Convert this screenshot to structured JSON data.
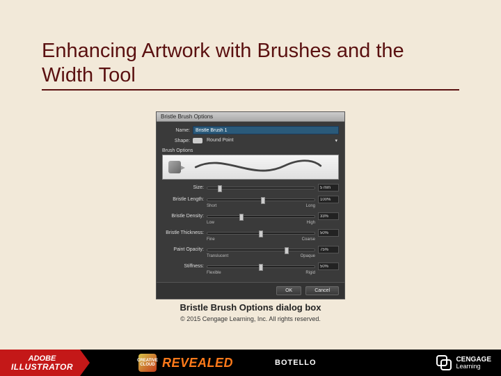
{
  "slide": {
    "title": "Enhancing Artwork with Brushes and the Width Tool",
    "caption": "Bristle Brush Options dialog box",
    "copyright": "© 2015 Cengage Learning, Inc. All rights reserved."
  },
  "dialog": {
    "title": "Bristle Brush Options",
    "name_label": "Name:",
    "name_value": "Bristle Brush 1",
    "shape_label": "Shape:",
    "shape_value": "Round Point",
    "section_label": "Brush Options",
    "sliders": [
      {
        "label": "Size:",
        "value": "5 mm",
        "min_label": "",
        "max_label": "",
        "pos": 10
      },
      {
        "label": "Bristle Length:",
        "value": "100%",
        "min_label": "Short",
        "max_label": "Long",
        "pos": 50
      },
      {
        "label": "Bristle Density:",
        "value": "33%",
        "min_label": "Low",
        "max_label": "High",
        "pos": 30
      },
      {
        "label": "Bristle Thickness:",
        "value": "50%",
        "min_label": "Fine",
        "max_label": "Coarse",
        "pos": 48
      },
      {
        "label": "Paint Opacity:",
        "value": "75%",
        "min_label": "Translucent",
        "max_label": "Opaque",
        "pos": 72
      },
      {
        "label": "Stiffness:",
        "value": "50%",
        "min_label": "Flexible",
        "max_label": "Rigid",
        "pos": 48
      }
    ],
    "ok": "OK",
    "cancel": "Cancel"
  },
  "footer": {
    "adobe_line1": "ADOBE",
    "adobe_line2": "ILLUSTRATOR",
    "cc_badge": "CREATIVE CLOUD",
    "revealed": "REVEALED",
    "author": "BOTELLO",
    "cengage1": "CENGAGE",
    "cengage2": "Learning"
  }
}
